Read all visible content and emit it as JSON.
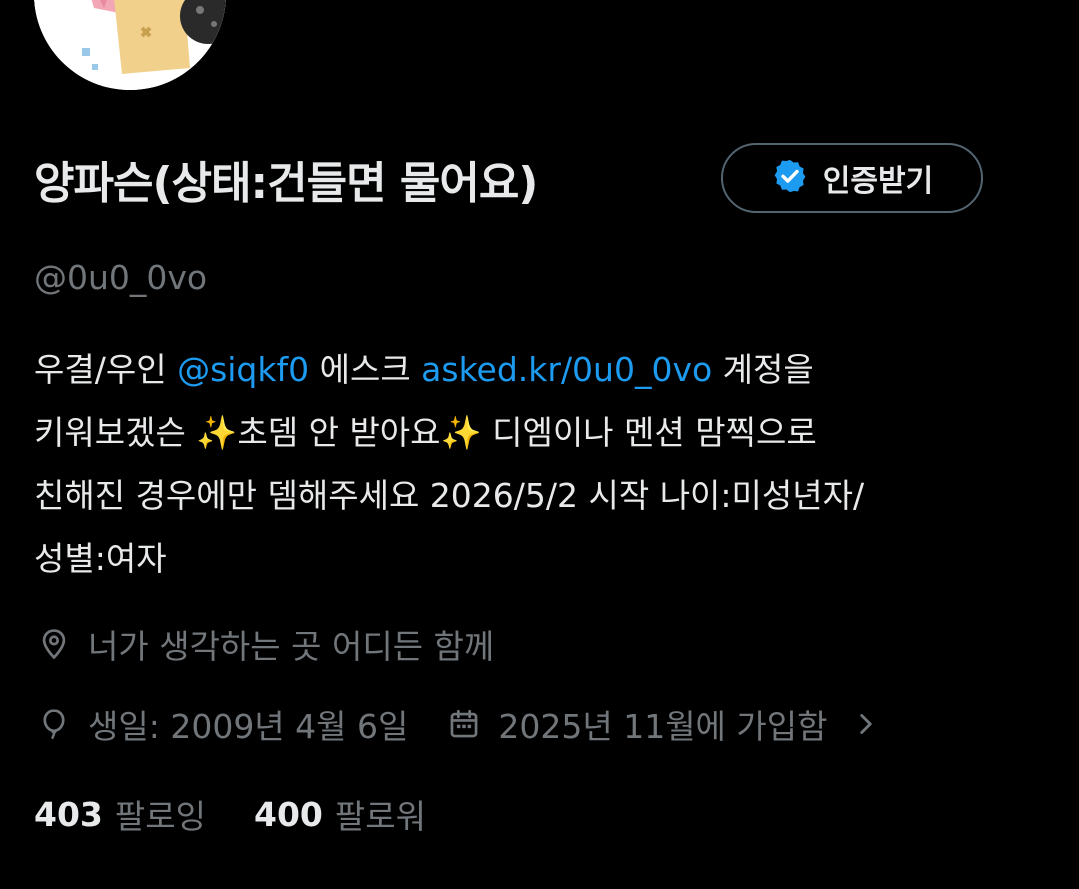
{
  "profile": {
    "display_name": "양파슨(상태:건들면 물어요)",
    "handle": "@0u0_0vo",
    "verify_button_label": "인증받기",
    "bio": {
      "line1_a": "우결/우인 ",
      "line1_link1": "@siqkf0",
      "line1_b": " 에스크 ",
      "line1_link2": "asked.kr/0u0_0vo",
      "line1_c": " 계정을",
      "line2": "키워보겠슨 ✨초뎀 안 받아요✨ 디엠이나 멘션 맘찍으로",
      "line3": "친해진 경우에만 뎀해주세요 2026/5/2 시작 나이:미성년자/",
      "line4": "성별:여자"
    },
    "location": "너가 생각하는 곳 어디든 함께",
    "birthday": "생일: 2009년 4월 6일",
    "joined": "2025년 11월에 가입함",
    "following_count": "403",
    "following_label": "팔로잉",
    "followers_count": "400",
    "followers_label": "팔로워"
  },
  "icons": {
    "verify": "verified-badge-icon",
    "location": "location-pin-icon",
    "birthday": "balloon-icon",
    "joined": "calendar-icon",
    "more": "chevron-right-icon"
  },
  "colors": {
    "background": "#000000",
    "text_primary": "#e7e9ea",
    "text_secondary": "#71767b",
    "link": "#1d9bf0",
    "button_border": "#536471",
    "verified_blue": "#1d9bf0"
  }
}
